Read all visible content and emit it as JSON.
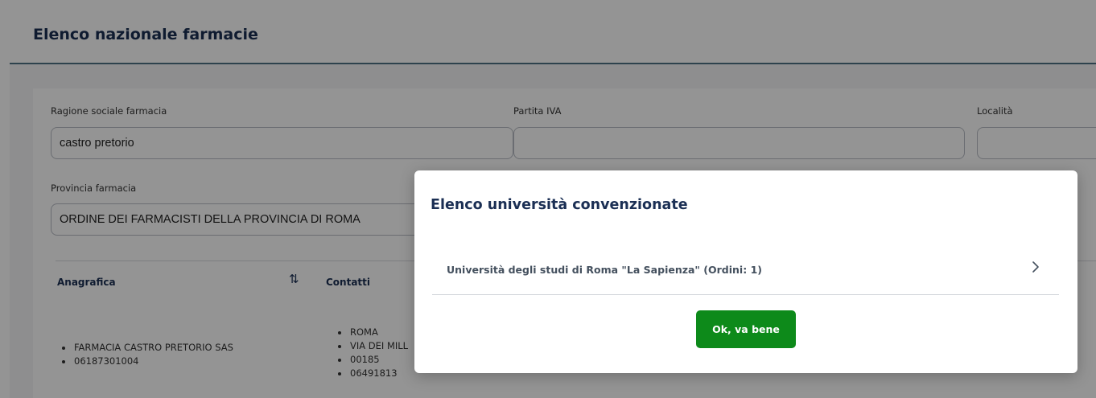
{
  "page": {
    "title": "Elenco nazionale farmacie"
  },
  "filters": {
    "ragione_sociale": {
      "label": "Ragione sociale farmacia",
      "value": "castro pretorio"
    },
    "partita_iva": {
      "label": "Partita IVA",
      "value": ""
    },
    "localita": {
      "label": "Località",
      "value": ""
    },
    "provincia": {
      "label": "Provincia farmacia",
      "value": "ORDINE DEI FARMACISTI DELLA PROVINCIA DI ROMA"
    }
  },
  "table": {
    "columns": [
      "Anagrafica",
      "Contatti"
    ],
    "sort_icon": "sort-arrows-icon",
    "rows": [
      {
        "anagrafica": [
          "FARMACIA CASTRO PRETORIO SAS",
          "06187301004"
        ],
        "contatti": [
          "ROMA",
          "VIA DEI MILL",
          "00185",
          "06491813"
        ]
      }
    ]
  },
  "modal": {
    "title": "Elenco università convenzionate",
    "items": [
      {
        "label": "Università degli studi di Roma \"La Sapienza\" (Ordini: 1)",
        "icon": "chevron-right-icon"
      }
    ],
    "ok_label": "Ok, va bene",
    "ok_color": "#0d8a1a"
  }
}
